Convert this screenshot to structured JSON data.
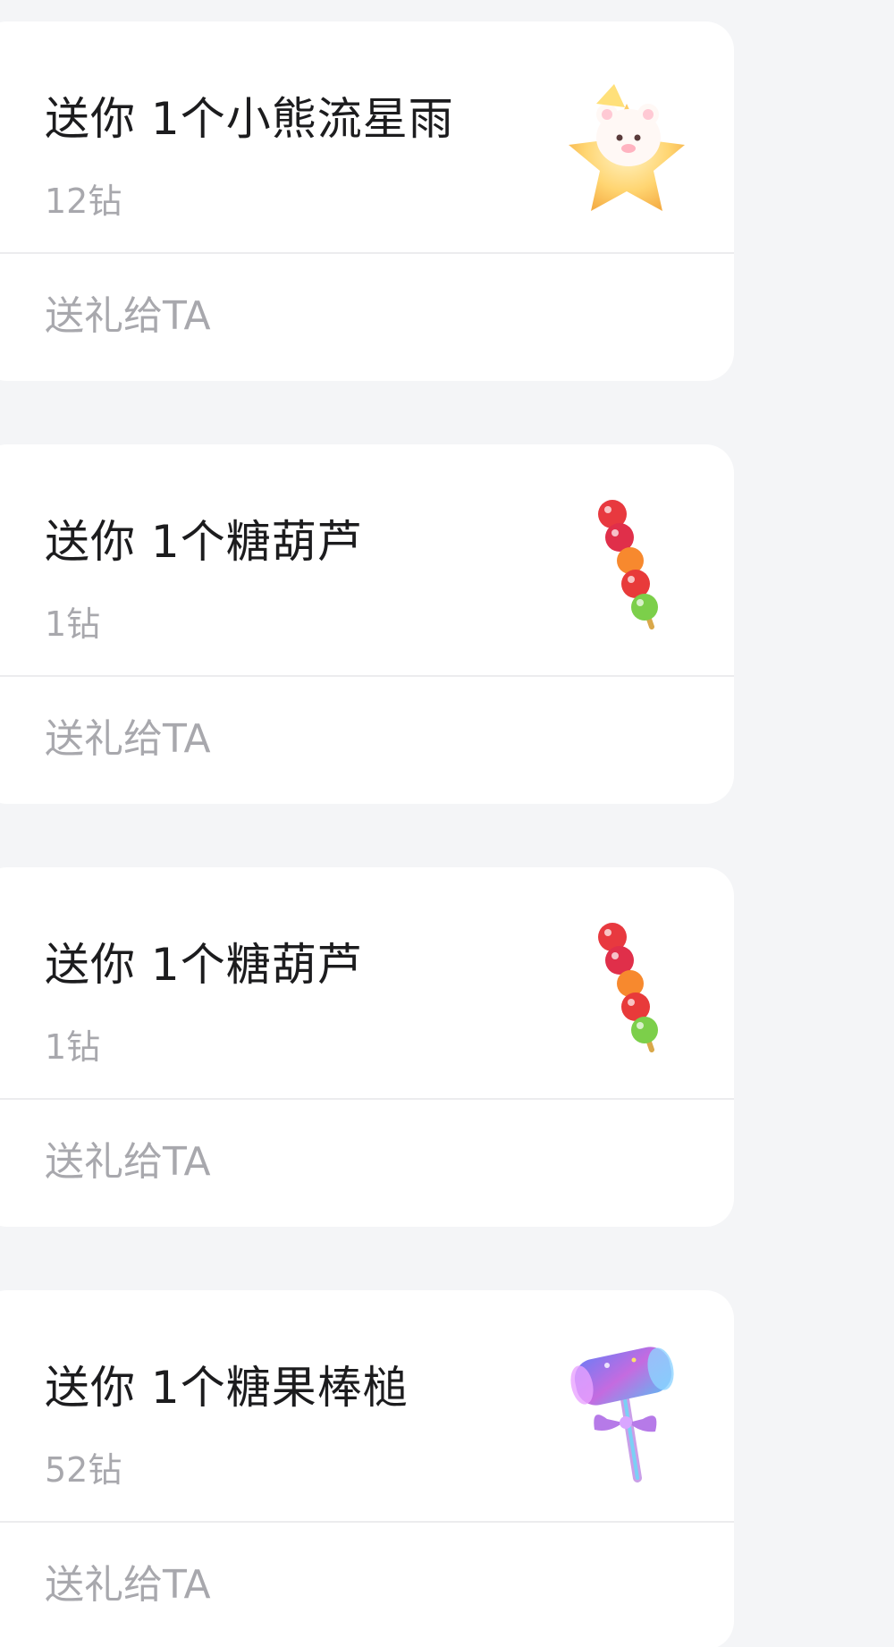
{
  "gifts": [
    {
      "title": "送你 1个小熊流星雨",
      "price": "12钻",
      "action": "送礼给TA",
      "icon": "bear-meteor-shower-icon"
    },
    {
      "title": "送你 1个糖葫芦",
      "price": "1钻",
      "action": "送礼给TA",
      "icon": "candied-haws-icon"
    },
    {
      "title": "送你 1个糖葫芦",
      "price": "1钻",
      "action": "送礼给TA",
      "icon": "candied-haws-icon"
    },
    {
      "title": "送你 1个糖果棒槌",
      "price": "52钻",
      "action": "送礼给TA",
      "icon": "candy-mallet-icon"
    }
  ]
}
